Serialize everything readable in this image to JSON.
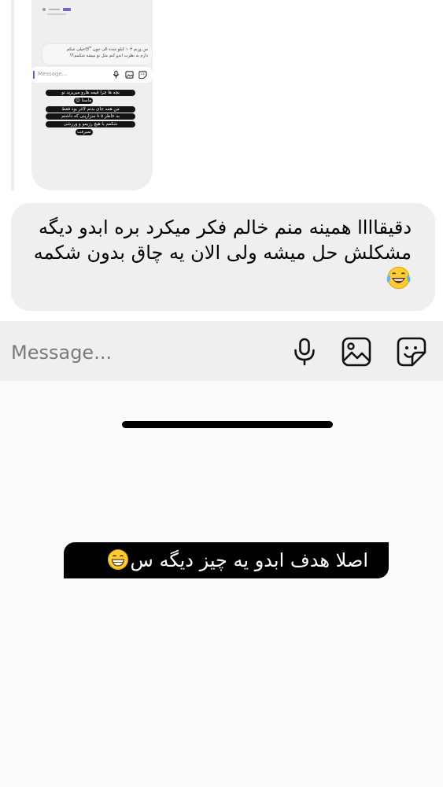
{
  "thumbnail": {
    "bubble_lines": [
      "من وزنم ۱۰۳ کیلو شده الی جون 😴خیلی شکم",
      "دارم به نظرت ابدو کنم مثل تو میشه شکمم؟؟"
    ],
    "input_placeholder": "Message...",
    "story_lines": [
      "بچه ها چرا قیمه هارو میریزید تو",
      "ماستا 😊",
      "من همه جای بدنم لاغر بود فقط",
      "به خاطر ۵ تا سزارینی که داشتم",
      "شکمم با هیچ رژیمو و ورزشی",
      "نمیرفت"
    ]
  },
  "message": {
    "text": "دقیقاااا همینه منم خالم فکر میکرد بره ابدو دیگه مشکلش حل میشه ولی الان یه چاق بدون شکمه",
    "emoji": "face-with-tears-of-joy"
  },
  "composer": {
    "placeholder": "Message...",
    "icons": [
      "microphone-icon",
      "gallery-icon",
      "sticker-icon"
    ]
  },
  "story": {
    "caption": "اصلا هدف ابدو یه چیز دیگه س",
    "caption_emoji": "grinning-face"
  },
  "colors": {
    "bubble_bg": "#efefef",
    "composer_bg": "#efefef",
    "caption_bg": "#000000"
  }
}
